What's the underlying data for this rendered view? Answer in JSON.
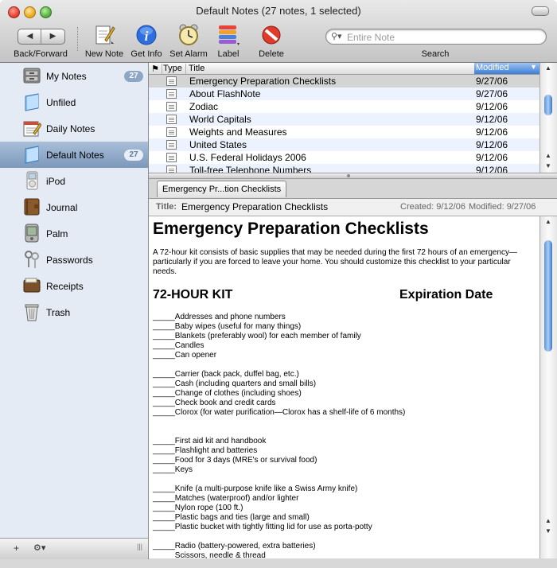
{
  "window": {
    "title": "Default Notes (27 notes, 1 selected)"
  },
  "toolbar": {
    "back_forward_label": "Back/Forward",
    "new_note_label": "New Note",
    "get_info_label": "Get Info",
    "set_alarm_label": "Set Alarm",
    "label_label": "Label",
    "delete_label": "Delete",
    "search_placeholder": "Entire Note",
    "search_label": "Search"
  },
  "sidebar": {
    "items": [
      {
        "label": "My Notes",
        "badge": "27",
        "icon": "drawer-icon"
      },
      {
        "label": "Unfiled",
        "icon": "folder-icon"
      },
      {
        "label": "Daily Notes",
        "icon": "calendar-notes-icon"
      },
      {
        "label": "Default Notes",
        "badge": "27",
        "icon": "folder-icon",
        "selected": true
      },
      {
        "label": "iPod",
        "icon": "ipod-icon"
      },
      {
        "label": "Journal",
        "icon": "journal-icon"
      },
      {
        "label": "Palm",
        "icon": "palm-icon"
      },
      {
        "label": "Passwords",
        "icon": "keys-icon"
      },
      {
        "label": "Receipts",
        "icon": "wallet-icon"
      },
      {
        "label": "Trash",
        "icon": "trash-icon"
      }
    ],
    "footer": {
      "add": "+",
      "action": "⚙▾",
      "resize": "|||"
    }
  },
  "list": {
    "headers": {
      "flag": "⚑",
      "type": "Type",
      "title": "Title",
      "modified": "Modified"
    },
    "rows": [
      {
        "title": "Emergency Preparation Checklists",
        "modified": "9/27/06",
        "selected": true
      },
      {
        "title": "About FlashNote",
        "modified": "9/27/06"
      },
      {
        "title": "Zodiac",
        "modified": "9/12/06"
      },
      {
        "title": "World Capitals",
        "modified": "9/12/06"
      },
      {
        "title": "Weights and Measures",
        "modified": "9/12/06"
      },
      {
        "title": "United States",
        "modified": "9/12/06"
      },
      {
        "title": "U.S. Federal Holidays 2006",
        "modified": "9/12/06"
      },
      {
        "title": "Toll-free Telephone Numbers",
        "modified": "9/12/06"
      }
    ]
  },
  "detail": {
    "tab_label": "Emergency Pr...tion Checklists",
    "title_label": "Title:",
    "title_value": "Emergency Preparation Checklists",
    "created": "Created: 9/12/06",
    "modified": "Modified: 9/27/06",
    "heading": "Emergency Preparation Checklists",
    "intro": "A 72-hour kit consists of basic supplies that may be needed during  the first 72 hours of an emergency—particularly if you are forced to leave your home. You should customize this checklist to your particular needs.",
    "section_left": "72-HOUR KIT",
    "section_right": "Expiration Date",
    "checklist": [
      "_____Addresses and phone numbers",
      "_____Baby wipes (useful for many things)",
      "_____Blankets (preferably wool) for each member of family",
      "_____Candles",
      "_____Can opener",
      "",
      "_____Carrier (back pack, duffel bag, etc.)",
      "_____Cash (including quarters and small bills)",
      "_____Change of clothes (including shoes)",
      "_____Check book and credit cards",
      "_____Clorox (for water purification—Clorox has a shelf-life of 6 months)",
      "",
      "",
      "_____First aid kit and handbook",
      "_____Flashlight and batteries",
      "_____Food for 3 days (MRE's or survival food)",
      "_____Keys",
      "",
      "_____Knife (a multi-purpose knife like a Swiss Army knife)",
      "_____Matches (waterproof) and/or lighter",
      "_____Nylon rope (100 ft.)",
      "_____Plastic bags and ties (large and small)",
      "_____Plastic bucket with tightly fitting lid for use as porta-potty",
      "",
      "_____Radio (battery-powered, extra batteries)",
      "_____Scissors, needle & thread"
    ]
  }
}
